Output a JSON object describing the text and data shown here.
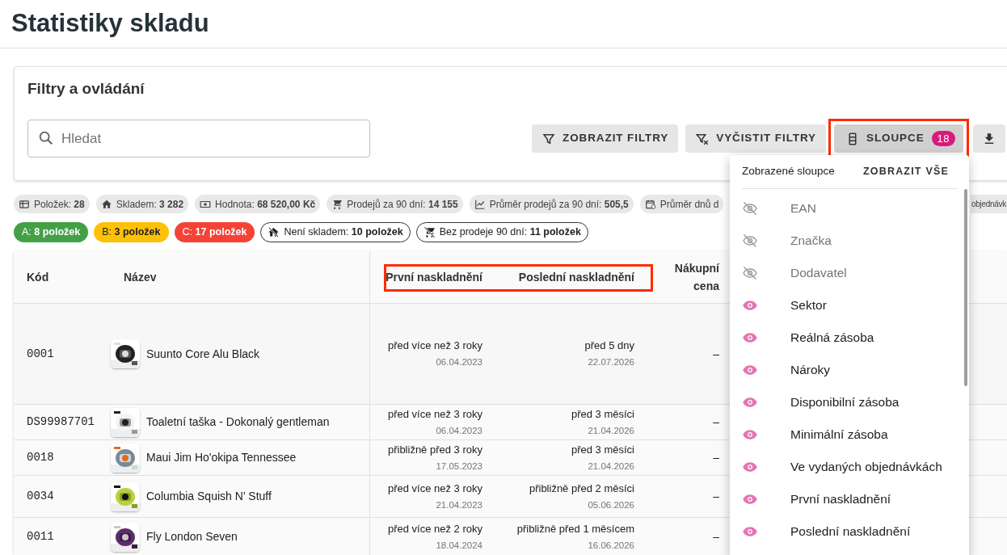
{
  "page_title": "Statistiky skladu",
  "filters_card": {
    "title": "Filtry a ovládání",
    "search": {
      "placeholder": "Hledat"
    },
    "buttons": [
      {
        "label": "ZOBRAZIT FILTRY",
        "kind": "filter"
      },
      {
        "label": "VYČISTIT FILTRY",
        "kind": "clear"
      },
      {
        "label": "SLOUPCE",
        "kind": "columns",
        "badge": "18",
        "highlighted": true
      },
      {
        "kind": "download"
      }
    ]
  },
  "summary_chips": [
    {
      "kind": "count",
      "text": "Položek: **28**"
    },
    {
      "kind": "stock",
      "text": "Skladem: **3 282**"
    },
    {
      "kind": "value",
      "text": "Hodnota: **68 520,00 Kč**"
    },
    {
      "kind": "sales",
      "text": "Prodejů za 90 dní: **14 155**"
    },
    {
      "kind": "average",
      "text": "Průměr prodejů za 90 dní: **505,5**"
    },
    {
      "kind": "days",
      "text": "Průměr dnů d"
    },
    {
      "kind": "fragment",
      "text": "objednávk"
    }
  ],
  "class_chips": [
    {
      "kind": "filled",
      "color": "#43a047",
      "text": "A: **8 položek**"
    },
    {
      "kind": "filled",
      "color": "#ffc107",
      "text": "B: **3 položek**"
    },
    {
      "kind": "filled",
      "color": "#f44336",
      "text": "C: **17 položek**"
    },
    {
      "kind": "no-stock",
      "text": "Není skladem: **10 položek**"
    },
    {
      "kind": "no-sales",
      "text": "Bez prodeje 90 dní: **11 položek**"
    }
  ],
  "table": {
    "columns": [
      "Kód",
      "Název",
      "První naskladnění",
      "Poslední naskladnění",
      "Nákupní cena"
    ],
    "header_highlighted": true,
    "rows": [
      {
        "code": "0001",
        "name": "Suunto Core Alu Black",
        "first": {
          "relative": "před více než 3 roky",
          "date": "06.04.2023"
        },
        "last": {
          "relative": "před 5 dny",
          "date": "22.07.2026"
        },
        "price": "–"
      },
      {
        "code": "DS99987701",
        "name": "Toaletní taška - Dokonalý gentleman",
        "first": {
          "relative": "před více než 3 roky",
          "date": "06.04.2023"
        },
        "last": {
          "relative": "před 3 měsíci",
          "date": "21.04.2026"
        },
        "price": "–"
      },
      {
        "code": "0018",
        "name": "Maui Jim Ho'okipa Tennessee",
        "first": {
          "relative": "přibližně před 3 roky",
          "date": "17.05.2023"
        },
        "last": {
          "relative": "před 3 měsíci",
          "date": "21.04.2026"
        },
        "price": "–"
      },
      {
        "code": "0034",
        "name": "Columbia Squish N’ Stuff",
        "first": {
          "relative": "před více než 3 roky",
          "date": "21.04.2023"
        },
        "last": {
          "relative": "přibližně před 2 měsíci",
          "date": "05.06.2026"
        },
        "price": "–"
      },
      {
        "code": "0011",
        "name": "Fly London Seven",
        "first": {
          "relative": "před více než 2 roky",
          "date": "18.04.2024"
        },
        "last": {
          "relative": "přibližně před 1 měsícem",
          "date": "16.06.2026"
        },
        "price": "–"
      }
    ]
  },
  "columns_menu": {
    "title": "Zobrazené sloupce",
    "show_all": "ZOBRAZIT VŠE",
    "items": [
      {
        "label": "EAN",
        "visible": false
      },
      {
        "label": "Značka",
        "visible": false
      },
      {
        "label": "Dodavatel",
        "visible": false
      },
      {
        "label": "Sektor",
        "visible": true
      },
      {
        "label": "Reálná zásoba",
        "visible": true
      },
      {
        "label": "Nároky",
        "visible": true
      },
      {
        "label": "Disponibilní zásoba",
        "visible": true
      },
      {
        "label": "Minimální zásoba",
        "visible": true
      },
      {
        "label": "Ve vydaných objednávkách",
        "visible": true
      },
      {
        "label": "První naskladnění",
        "visible": true
      },
      {
        "label": "Poslední naskladnění",
        "visible": true
      }
    ]
  }
}
